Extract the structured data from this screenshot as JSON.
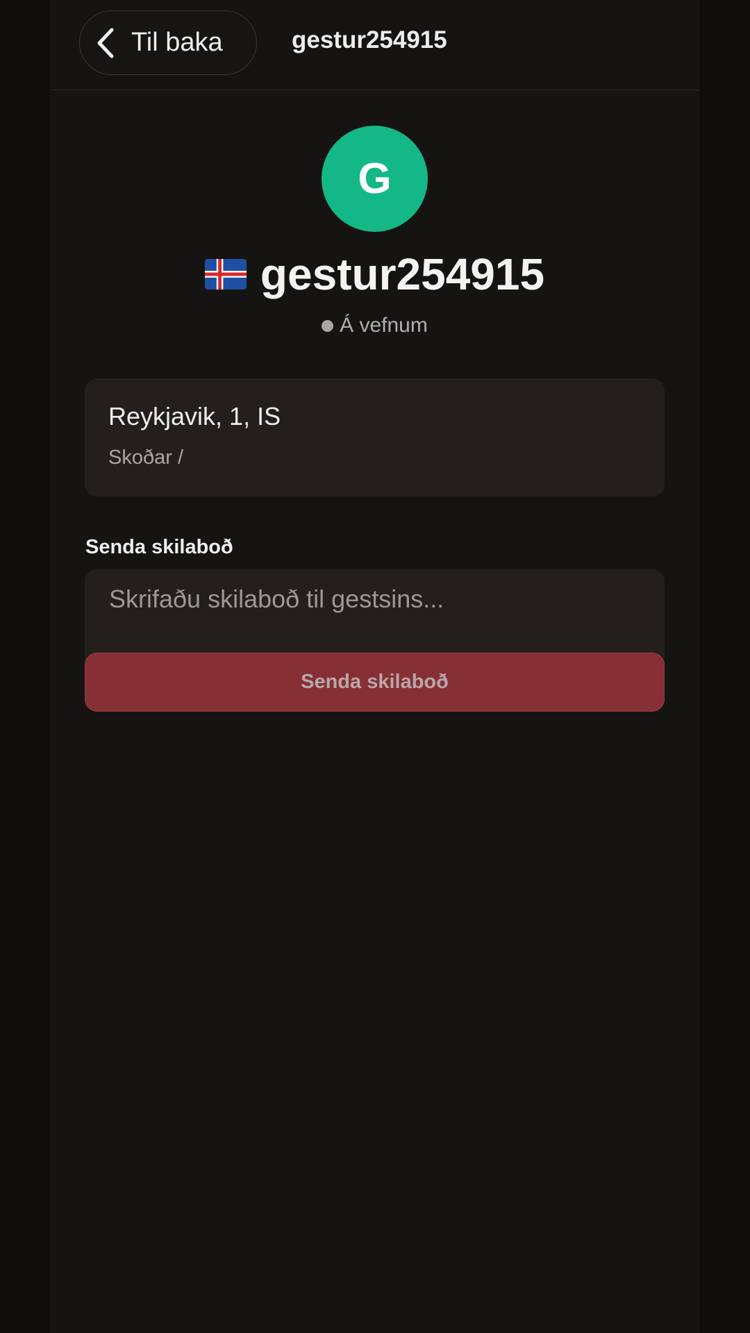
{
  "header": {
    "back_label": "Til baka",
    "title": "gestur254915"
  },
  "profile": {
    "avatar_letter": "G",
    "avatar_color": "#13b886",
    "flag_icon": "iceland-flag-icon",
    "username": "gestur254915",
    "status": "Á vefnum"
  },
  "info": {
    "location": "Reykjavik, 1, IS",
    "views": "Skoðar /"
  },
  "message": {
    "section_label": "Senda skilaboð",
    "placeholder": "Skrifaðu skilaboð til gestsins...",
    "value": "",
    "send_label": "Senda skilaboð",
    "send_color": "#862f35"
  }
}
